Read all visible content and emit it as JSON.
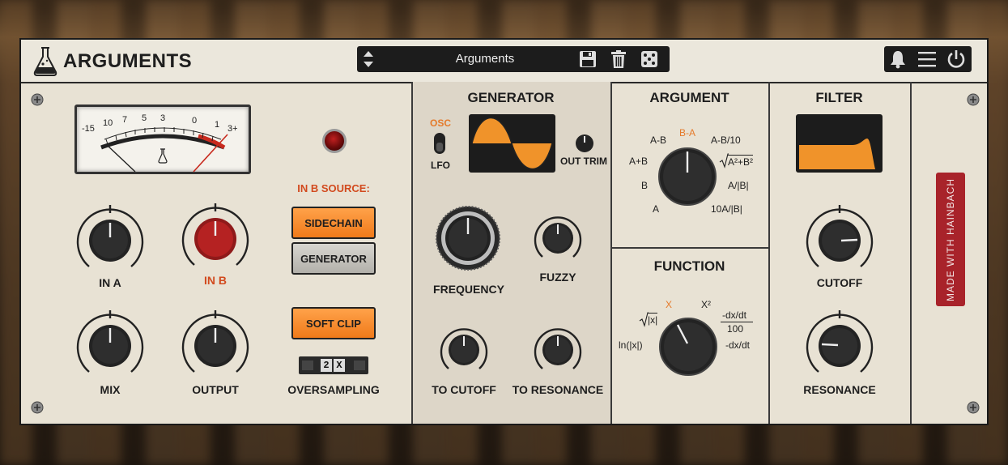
{
  "header": {
    "brand": "ARGUMENTS",
    "preset_name": "Arguments",
    "icons": {
      "logo": "flask-icon",
      "preset_nav": "up-down-arrows-icon",
      "save": "floppy-disk-icon",
      "delete": "trash-icon",
      "random": "dice-icon",
      "notifications": "bell-icon",
      "menu": "hamburger-menu-icon",
      "power": "power-icon"
    }
  },
  "main": {
    "vu_scale": [
      "-15",
      "10",
      "7",
      "5",
      "3",
      "0",
      "1",
      "3+"
    ],
    "in_b_source_label": "IN B SOURCE:",
    "sidechain_label": "SIDECHAIN",
    "generator_label": "GENERATOR",
    "soft_clip_label": "SOFT CLIP",
    "oversampling_value": "2",
    "oversampling_suffix": "X",
    "knobs": {
      "in_a": "IN A",
      "in_b": "IN B",
      "mix": "MIX",
      "output": "OUTPUT"
    },
    "oversampling_label": "OVERSAMPLING"
  },
  "generator": {
    "title": "GENERATOR",
    "osc_label": "OSC",
    "lfo_label": "LFO",
    "out_trim_label": "OUT TRIM",
    "frequency_label": "FREQUENCY",
    "fuzzy_label": "FUZZY",
    "to_cutoff_label": "TO CUTOFF",
    "to_resonance_label": "TO RESONANCE"
  },
  "argument": {
    "title": "ARGUMENT",
    "options": {
      "a_minus_b": "A-B",
      "b_minus_a": "B-A",
      "a_b_10": "A-B/10",
      "a_plus_b": "A+B",
      "sqrt_a2b2": "A²+B²",
      "b": "B",
      "a_abs_b": "A/|B|",
      "a": "A",
      "ten_a_abs_b": "10A/|B|"
    }
  },
  "function": {
    "title": "FUNCTION",
    "options": {
      "x": "X",
      "x2": "X²",
      "sqrt_abs_x": "|x|",
      "dxdt_num": "-dx/dt",
      "dxdt_den": "100",
      "ln_abs_x": "ln(|x|)",
      "dxdt": "-dx/dt"
    }
  },
  "filter": {
    "title": "FILTER",
    "cutoff_label": "CUTOFF",
    "resonance_label": "RESONANCE"
  },
  "side": {
    "badge": "MADE WITH HAINBACH"
  },
  "colors": {
    "panel": "#e8e2d4",
    "accent_orange": "#f0932a",
    "accent_red": "#d24a1e",
    "screen": "#1c1c1c",
    "badge": "#a8232a"
  }
}
